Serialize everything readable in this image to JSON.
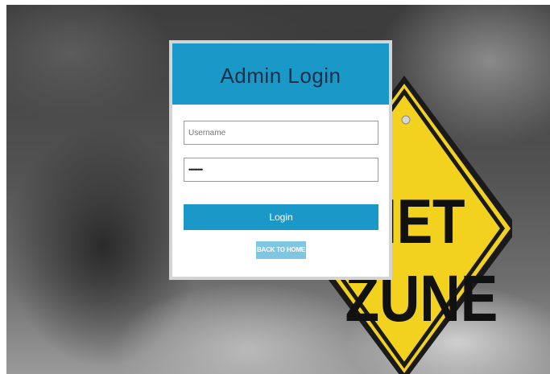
{
  "login": {
    "title": "Admin Login",
    "username_placeholder": "Username",
    "password_value": "••••••••",
    "login_label": "Login",
    "back_label": "BACK TO HOME"
  },
  "background": {
    "sign_line1": "IET",
    "sign_line2": "ZUNE"
  },
  "colors": {
    "header": "#1a98c8",
    "login_button": "#1a98c8",
    "back_button": "#7fc6e3",
    "sign": "#f2d21e"
  },
  "icons": [
    "storm-clouds-image",
    "quiet-zone-sign-image"
  ]
}
